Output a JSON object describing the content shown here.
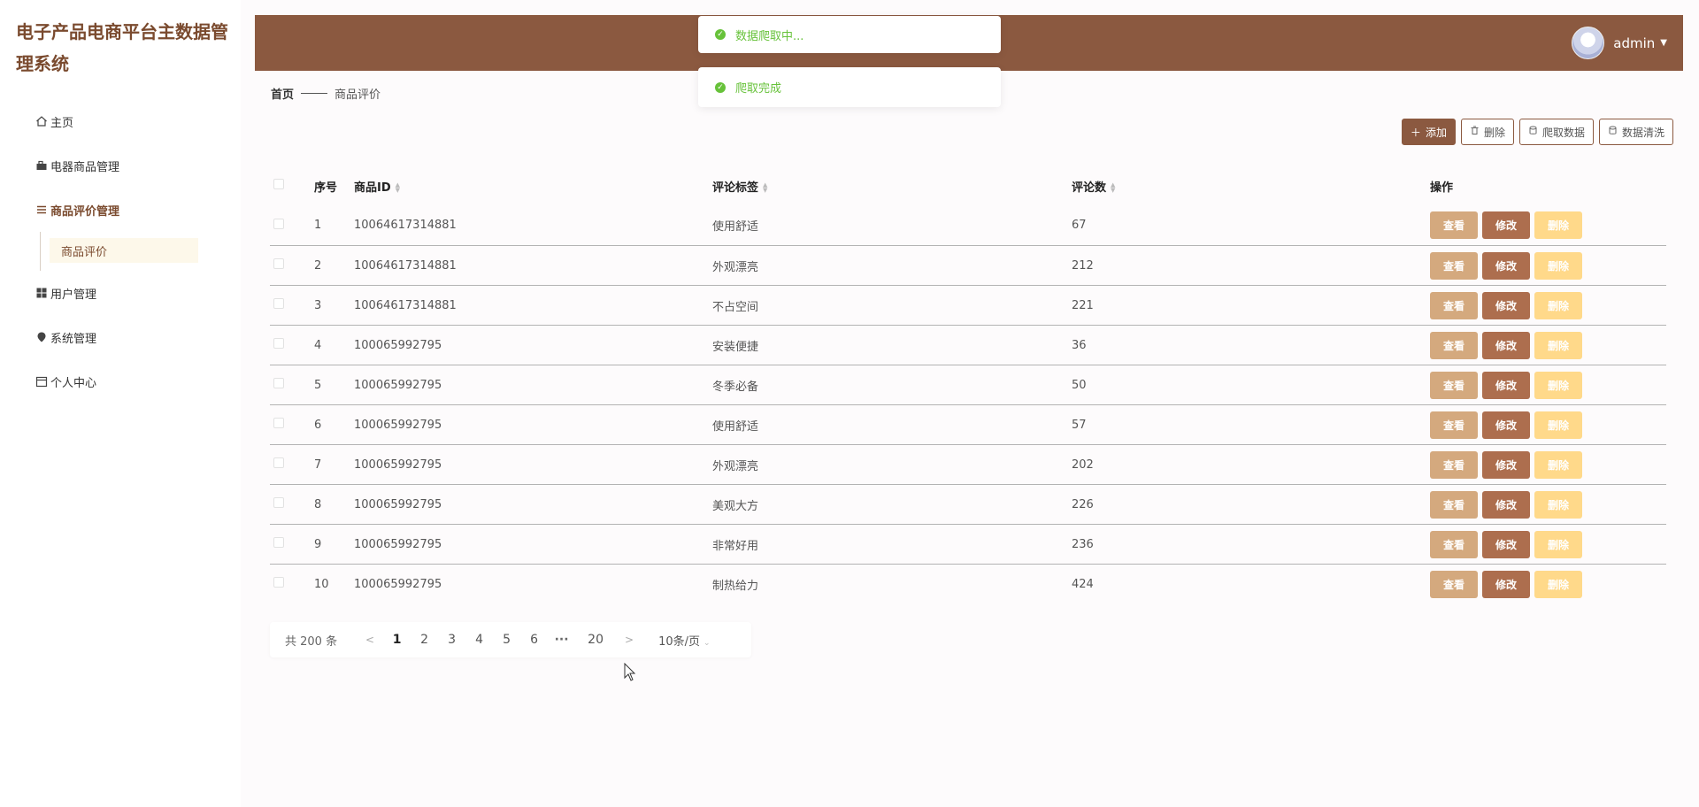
{
  "app": {
    "title": "电子产品电商平台主数据管理系统"
  },
  "sidebar": {
    "items": [
      {
        "label": "主页",
        "icon": "home-icon"
      },
      {
        "label": "电器商品管理",
        "icon": "briefcase-icon"
      },
      {
        "label": "商品评价管理",
        "icon": "list-icon"
      },
      {
        "label": "用户管理",
        "icon": "grid-icon"
      },
      {
        "label": "系统管理",
        "icon": "pin-icon"
      },
      {
        "label": "个人中心",
        "icon": "calendar-icon"
      }
    ],
    "submenu": {
      "label": "商品评价"
    }
  },
  "header": {
    "username": "admin"
  },
  "breadcrumb": {
    "home": "首页",
    "current": "商品评价"
  },
  "toolbar": {
    "add": "添加",
    "delete": "删除",
    "crawl": "爬取数据",
    "clean": "数据清洗"
  },
  "table": {
    "headers": {
      "index": "序号",
      "product_id": "商品ID",
      "tag": "评论标签",
      "count": "评论数",
      "ops": "操作"
    },
    "op_labels": {
      "view": "查看",
      "edit": "修改",
      "delete": "删除"
    },
    "rows": [
      {
        "index": "1",
        "product_id": "10064617314881",
        "tag": "使用舒适",
        "count": "67"
      },
      {
        "index": "2",
        "product_id": "10064617314881",
        "tag": "外观漂亮",
        "count": "212"
      },
      {
        "index": "3",
        "product_id": "10064617314881",
        "tag": "不占空间",
        "count": "221"
      },
      {
        "index": "4",
        "product_id": "100065992795",
        "tag": "安装便捷",
        "count": "36"
      },
      {
        "index": "5",
        "product_id": "100065992795",
        "tag": "冬季必备",
        "count": "50"
      },
      {
        "index": "6",
        "product_id": "100065992795",
        "tag": "使用舒适",
        "count": "57"
      },
      {
        "index": "7",
        "product_id": "100065992795",
        "tag": "外观漂亮",
        "count": "202"
      },
      {
        "index": "8",
        "product_id": "100065992795",
        "tag": "美观大方",
        "count": "226"
      },
      {
        "index": "9",
        "product_id": "100065992795",
        "tag": "非常好用",
        "count": "236"
      },
      {
        "index": "10",
        "product_id": "100065992795",
        "tag": "制热给力",
        "count": "424"
      }
    ]
  },
  "pagination": {
    "total": "共 200 条",
    "prev": "<",
    "next": ">",
    "pages": [
      "1",
      "2",
      "3",
      "4",
      "5",
      "6"
    ],
    "more": "···",
    "last": "20",
    "current": "1",
    "page_size": "10条/页"
  },
  "toasts": {
    "crawling": "数据爬取中...",
    "done": "爬取完成"
  },
  "colors": {
    "brand": "#8b5940",
    "view_button": "#d4a97e",
    "edit_button": "#ad6e4e",
    "delete_button": "#ffd98a",
    "success": "#67c23a"
  }
}
